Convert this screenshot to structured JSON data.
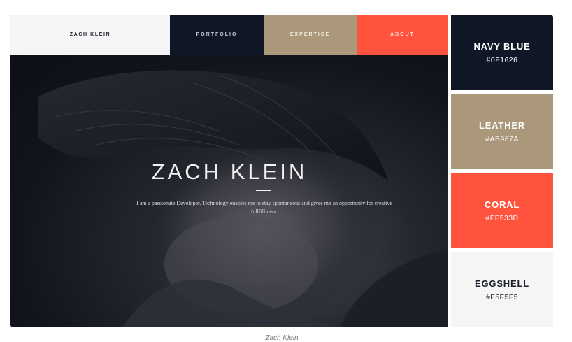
{
  "nav": {
    "logo": "ZACH KLEIN",
    "portfolio": "PORTFOLIO",
    "expertise": "EXPERTISE",
    "about": "ABOUT"
  },
  "hero": {
    "title": "ZACH KLEIN",
    "description": "I am a passionate Developer. Technology enables me to stay spontaneous and gives me an opportunity for creative fullfillment."
  },
  "palette": [
    {
      "name": "NAVY BLUE",
      "hex": "#0F1626",
      "color": "#0f1626"
    },
    {
      "name": "LEATHER",
      "hex": "#AB987A",
      "color": "#ab987a"
    },
    {
      "name": "CORAL",
      "hex": "#FF533D",
      "color": "#ff533d"
    },
    {
      "name": "EGGSHELL",
      "hex": "#F5F5F5",
      "color": "#f5f5f5"
    }
  ],
  "caption": "Zach Klein"
}
